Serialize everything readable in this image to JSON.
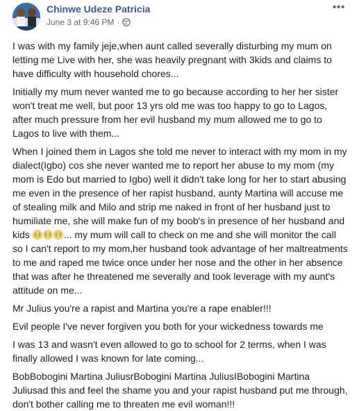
{
  "post": {
    "author": "Chinwe Udeze Patricia",
    "date": "June 3 at 9:46 PM",
    "separator": "·",
    "more_label": "•••",
    "emoji_count_note": "",
    "paragraphs": [
      "I was with my family jeje,when aunt called severally disturbing my mum on letting me Live with her, she was heavily pregnant with 3kids and claims to have difficulty with household chores...",
      "Initially my mum never wanted me to go because according to her her sister won't treat me well, but poor 13 yrs old me was too happy to go to Lagos, after much pressure from her evil husband my mum allowed me to go to Lagos to live with them...",
      "Mr Julius you're a rapist and Martina you're a rape enabler!!!",
      "Evil people I've never forgiven you both for your wickedness towards me",
      "I was 13 and wasn't even allowed to go to school for 2 terms, when I was finally allowed I was known for late coming...",
      "BobBobogini Martina JuliusrBobogini Martina JuliusIBobogini Martina Juliusad this and feel the shame you and your rapist husband put me through, don't bother calling me to threaten me evil woman!!!"
    ],
    "long_paragraph_part1": "When I joined them in Lagos she told me never to interact with my mom in my dialect(Igbo) cos she never wanted me to report her abuse to my mom (my mom is Edo but married to Igbo) well it didn't take long for her to start abusing me even in the presence of her rapist husband, aunty Martina will accuse me of stealing milk and Milo and strip me naked in front of her husband just to humiliate me, she will make fun of my boob's in presence of her husband and kids",
    "long_paragraph_part2": "... my mum will call to check on me and she will monitor the call so I can't report to my mom,her husband took advantage of her maltreatments to me and raped me twice once under her nose and the other in her absence that was after he threatened me severally and took leverage with my aunt's attitude on me..."
  },
  "colors": {
    "author": "#385898",
    "meta": "#606770",
    "text": "#1c1e21"
  },
  "icons": {
    "avatar": "profile-photo",
    "privacy": "globe-icon",
    "more": "more-options-icon",
    "emoji": "crying-face-emoji"
  }
}
